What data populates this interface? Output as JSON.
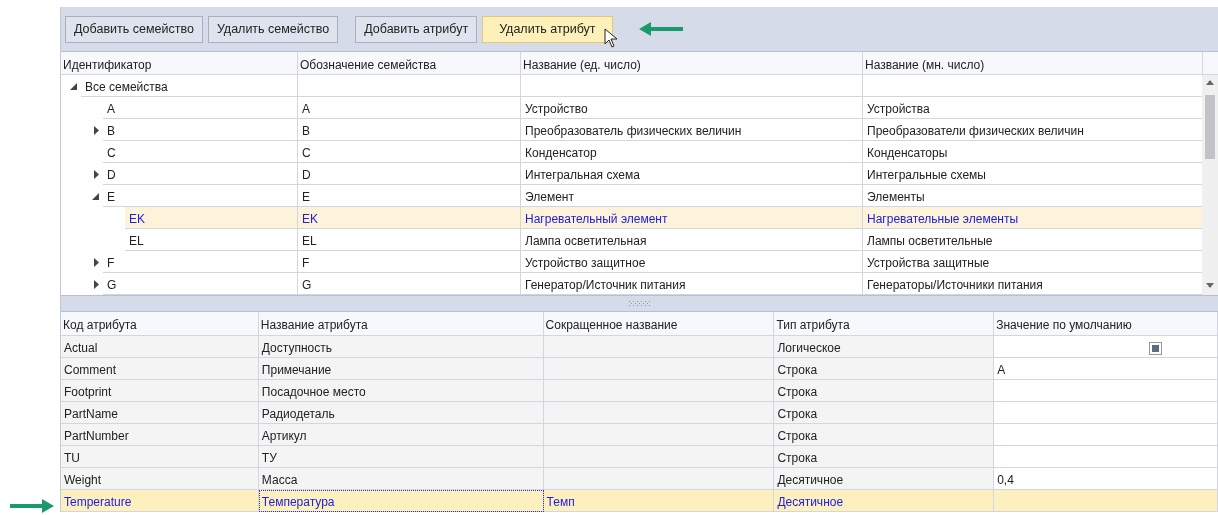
{
  "toolbar": {
    "groups": [
      [
        {
          "label": "Добавить семейство",
          "hovered": false
        },
        {
          "label": "Удалить семейство",
          "hovered": false
        }
      ],
      [
        {
          "label": "Добавить атрибут",
          "hovered": false
        },
        {
          "label": "Удалить атрибут",
          "hovered": true
        }
      ]
    ]
  },
  "families": {
    "columns": [
      "Идентификатор",
      "Обозначение семейства",
      "Название (ед. число)",
      "Название (мн. число)"
    ],
    "rows": [
      {
        "id": "Все семейства",
        "expanded": true,
        "selected": false,
        "children": [
          {
            "id": "A",
            "designation": "A",
            "name_singular": "Устройство",
            "name_plural": "Устройства",
            "selected": false
          },
          {
            "id": "B",
            "designation": "B",
            "name_singular": "Преобразователь физических величин",
            "name_plural": "Преобразователи физических величин",
            "expanded": false,
            "selected": false
          },
          {
            "id": "C",
            "designation": "C",
            "name_singular": "Конденсатор",
            "name_plural": "Конденсаторы",
            "selected": false
          },
          {
            "id": "D",
            "designation": "D",
            "name_singular": "Интегральная схема",
            "name_plural": "Интегральные схемы",
            "expanded": false,
            "selected": false
          },
          {
            "id": "E",
            "designation": "E",
            "name_singular": "Элемент",
            "name_plural": "Элементы",
            "expanded": true,
            "selected": false,
            "children": [
              {
                "id": "EK",
                "designation": "EK",
                "name_singular": "Нагревательный элемент",
                "name_plural": "Нагревательные элементы",
                "selected": true
              },
              {
                "id": "EL",
                "designation": "EL",
                "name_singular": "Лампа осветительная",
                "name_plural": "Лампы осветительные",
                "selected": false
              }
            ]
          },
          {
            "id": "F",
            "designation": "F",
            "name_singular": "Устройство защитное",
            "name_plural": "Устройства защитные",
            "expanded": false,
            "selected": false
          },
          {
            "id": "G",
            "designation": "G",
            "name_singular": "Генератор/Источник питания",
            "name_plural": "Генераторы/Источники питания",
            "expanded": false,
            "selected": false
          }
        ]
      }
    ]
  },
  "attributes": {
    "columns": [
      "Код атрибута",
      "Название атрибута",
      "Сокращенное название",
      "Тип атрибута",
      "Значение по умолчанию"
    ],
    "rows": [
      {
        "code": "Actual",
        "name": "Доступность",
        "type": "Логическое",
        "default": {
          "kind": "checkbox",
          "checked": true
        },
        "selected": false
      },
      {
        "code": "Comment",
        "name": "Примечание",
        "type": "Строка",
        "default": {
          "kind": "text",
          "value": "A"
        },
        "selected": false
      },
      {
        "code": "Footprint",
        "name": "Посадочное место",
        "type": "Строка",
        "selected": false
      },
      {
        "code": "PartName",
        "name": "Радиодеталь",
        "type": "Строка",
        "selected": false
      },
      {
        "code": "PartNumber",
        "name": "Артикул",
        "type": "Строка",
        "selected": false
      },
      {
        "code": "TU",
        "name": "ТУ",
        "type": "Строка",
        "selected": false
      },
      {
        "code": "Weight",
        "name": "Масса",
        "type": "Десятичное",
        "default": {
          "kind": "text",
          "value": "0,4"
        },
        "selected": false
      },
      {
        "code": "Temperature",
        "name": "Температура",
        "short_name": "Темп",
        "type": "Десятичное",
        "selected": true
      }
    ]
  }
}
